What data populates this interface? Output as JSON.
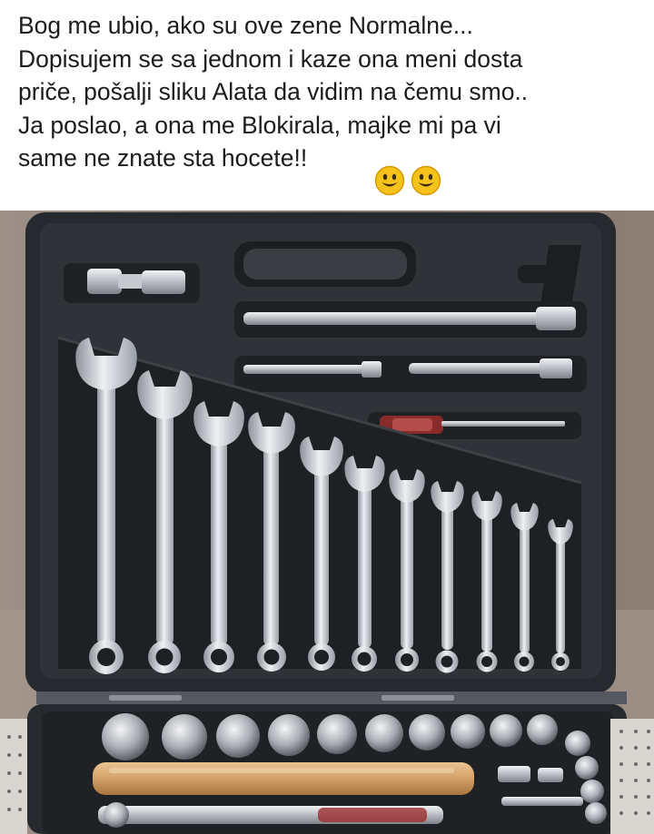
{
  "post": {
    "caption_lines": [
      "Bog me ubio, ako su ove zene Normalne...",
      "Dopisujem se sa jednom i kaze ona meni dosta",
      "priče, pošalji sliku Alata da vidim na čemu smo..",
      "Ja poslao, a ona me Blokirala, majke mi pa vi",
      "same ne znate sta hocete!!"
    ],
    "emojis": [
      "smiling-face-icon",
      "smiling-face-icon"
    ]
  },
  "photo": {
    "subject": "toolbox",
    "colors": {
      "case": "#2a2d31",
      "steel": "#c9ccd1",
      "handle": "#cf9e66",
      "background": "#8c7f75"
    }
  }
}
